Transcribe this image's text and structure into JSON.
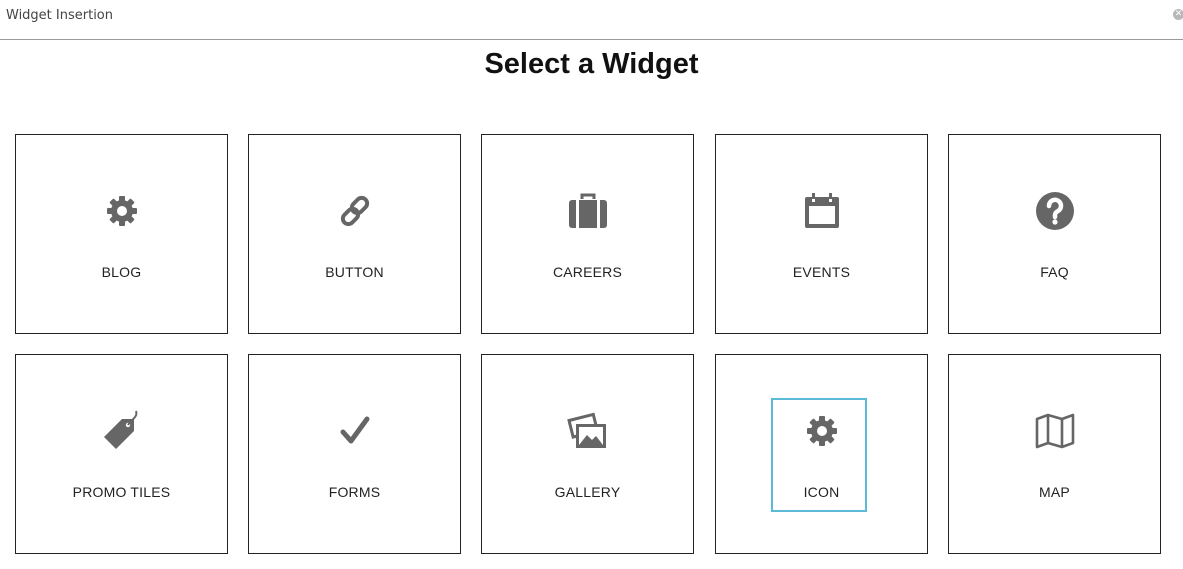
{
  "dialog": {
    "title": "Widget Insertion",
    "close_glyph": "✕"
  },
  "main": {
    "heading": "Select a Widget"
  },
  "icon_color": "#666666",
  "focus_color": "#5bbad5",
  "widgets": [
    {
      "label": "BLOG",
      "icon": "gear-icon"
    },
    {
      "label": "BUTTON",
      "icon": "link-icon"
    },
    {
      "label": "CAREERS",
      "icon": "briefcase-icon"
    },
    {
      "label": "EVENTS",
      "icon": "calendar-icon"
    },
    {
      "label": "FAQ",
      "icon": "question-circle-icon"
    },
    {
      "label": "PROMO TILES",
      "icon": "tag-icon"
    },
    {
      "label": "FORMS",
      "icon": "checkmark-icon"
    },
    {
      "label": "GALLERY",
      "icon": "images-icon"
    },
    {
      "label": "ICON",
      "icon": "gear-icon",
      "selected": true
    },
    {
      "label": "MAP",
      "icon": "map-icon"
    }
  ]
}
